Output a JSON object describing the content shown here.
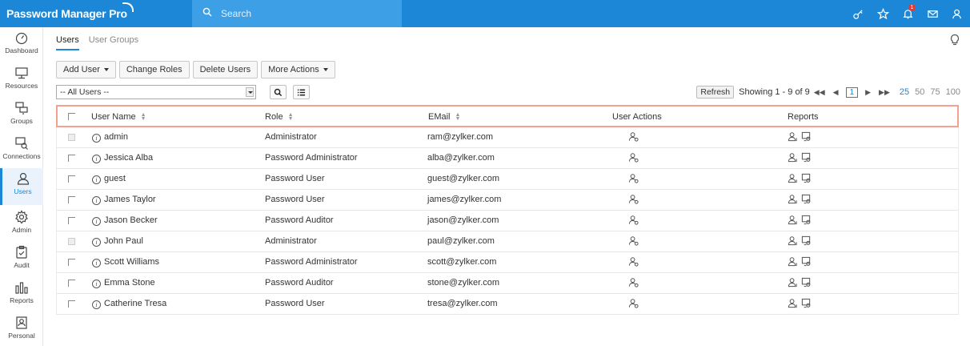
{
  "app": {
    "brand": "Password Manager Pro",
    "search_placeholder": "Search",
    "notification_count": "1"
  },
  "sidebar": {
    "items": [
      {
        "label": "Dashboard",
        "icon": "dashboard-icon"
      },
      {
        "label": "Resources",
        "icon": "monitor-icon"
      },
      {
        "label": "Groups",
        "icon": "groups-icon"
      },
      {
        "label": "Connections",
        "icon": "connections-icon"
      },
      {
        "label": "Users",
        "icon": "user-icon",
        "active": true
      },
      {
        "label": "Admin",
        "icon": "gear-icon"
      },
      {
        "label": "Audit",
        "icon": "clipboard-icon"
      },
      {
        "label": "Reports",
        "icon": "bar-chart-icon"
      },
      {
        "label": "Personal",
        "icon": "personal-icon"
      }
    ]
  },
  "tabs": [
    {
      "label": "Users",
      "active": true
    },
    {
      "label": "User Groups",
      "active": false
    }
  ],
  "toolbar": {
    "add_user": "Add User",
    "change_roles": "Change Roles",
    "delete_users": "Delete Users",
    "more_actions": "More Actions"
  },
  "filter": {
    "selected": "-- All Users --"
  },
  "pager": {
    "refresh": "Refresh",
    "showing": "Showing 1 - 9 of 9",
    "page": "1",
    "sizes": [
      "25",
      "50",
      "75",
      "100"
    ],
    "active_size": "25"
  },
  "table": {
    "columns": [
      "User Name",
      "Role",
      "EMail",
      "User Actions",
      "Reports"
    ],
    "rows": [
      {
        "name": "admin",
        "role": "Administrator",
        "email": "ram@zylker.com",
        "disabled": true
      },
      {
        "name": "Jessica Alba",
        "role": "Password Administrator",
        "email": "alba@zylker.com",
        "disabled": false
      },
      {
        "name": "guest",
        "role": "Password User",
        "email": "guest@zylker.com",
        "disabled": false
      },
      {
        "name": "James Taylor",
        "role": "Password User",
        "email": "james@zylker.com",
        "disabled": false
      },
      {
        "name": "Jason Becker",
        "role": "Password Auditor",
        "email": "jason@zylker.com",
        "disabled": false
      },
      {
        "name": "John Paul",
        "role": "Administrator",
        "email": "paul@zylker.com",
        "disabled": true
      },
      {
        "name": "Scott Williams",
        "role": "Password Administrator",
        "email": "scott@zylker.com",
        "disabled": false
      },
      {
        "name": "Emma Stone",
        "role": "Password Auditor",
        "email": "stone@zylker.com",
        "disabled": false
      },
      {
        "name": "Catherine Tresa",
        "role": "Password User",
        "email": "tresa@zylker.com",
        "disabled": false
      }
    ]
  },
  "colors": {
    "brand_blue": "#1b87d6",
    "search_bg": "#3da0e6",
    "header_highlight": "#f4a192"
  }
}
